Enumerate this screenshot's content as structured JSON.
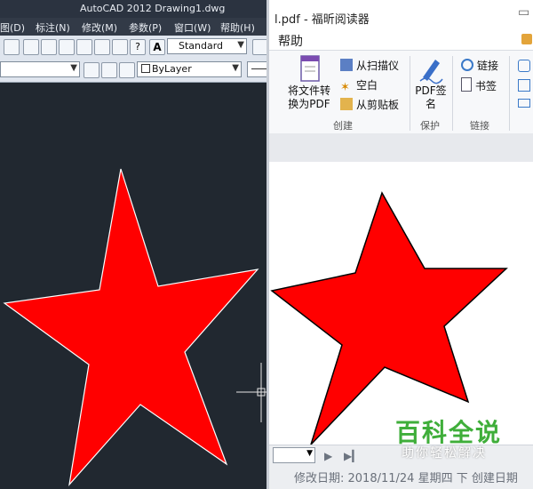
{
  "autocad": {
    "title": "AutoCAD 2012    Drawing1.dwg",
    "menus": [
      "图(D)",
      "标注(N)",
      "修改(M)",
      "参数(P)",
      "窗口(W)",
      "帮助(H)"
    ],
    "text_style_combo": "Standard",
    "layer_combo": "ByLayer",
    "colors": {
      "background": "#212830",
      "star_fill": "#ff0000",
      "star_outline": "#ffffff"
    }
  },
  "foxit": {
    "title": "l.pdf - 福昕阅读器",
    "tab": "帮助",
    "ribbon": {
      "convert_label": "将文件转换为PDF",
      "scan": "从扫描仪",
      "blank": "空白",
      "clipboard": "从剪贴板",
      "group_create": "创建",
      "pdf_sign": "PDF签名",
      "group_protect": "保护",
      "link": "链接",
      "bookmark": "书签",
      "group_links": "链接"
    },
    "status_text": "修改日期: 2018/11/24 星期四 下    创建日期",
    "colors": {
      "star_fill": "#ff0000",
      "star_outline": "#000000"
    }
  },
  "watermark": {
    "main": "百科全说",
    "sub": "助你轻松解决"
  }
}
